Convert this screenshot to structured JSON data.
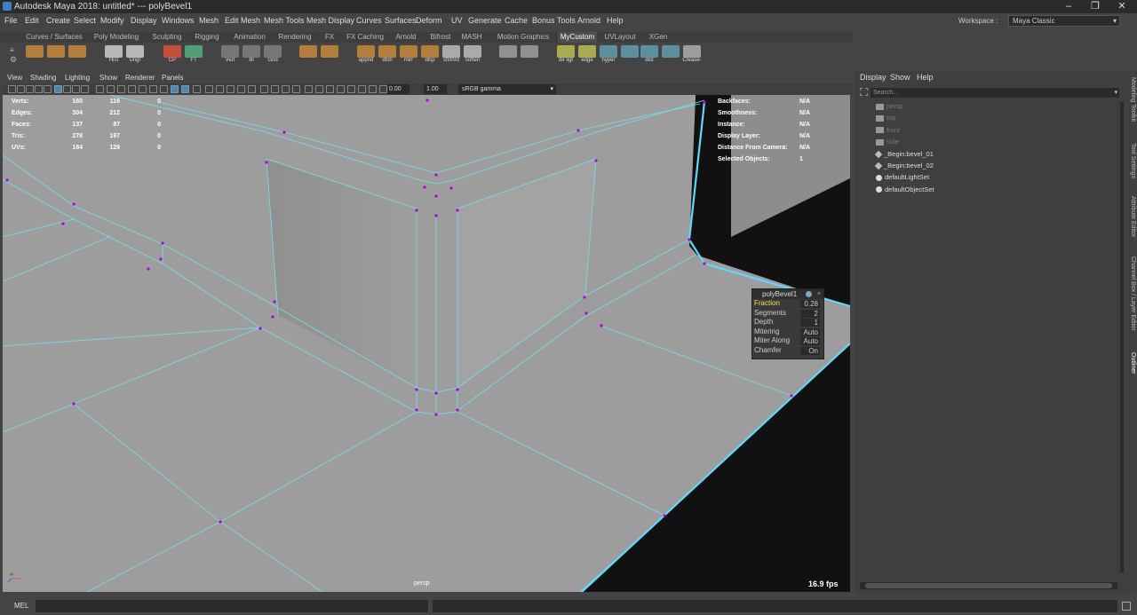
{
  "title_bar": {
    "title": "Autodesk Maya 2018: untitled*   ---   polyBevel1"
  },
  "menu": [
    "File",
    "Edit",
    "Create",
    "Select",
    "Modify",
    "Display",
    "Windows",
    "Mesh",
    "Edit Mesh",
    "Mesh Tools",
    "Mesh Display",
    "Curves",
    "Surfaces",
    "Deform",
    "UV",
    "Generate",
    "Cache",
    "Bonus Tools",
    "Arnold",
    "Help"
  ],
  "workspace": {
    "label": "Workspace :",
    "value": "Maya Classic"
  },
  "shelf_tabs": [
    "Curves / Surfaces",
    "Poly Modeling",
    "Sculpting",
    "Rigging",
    "Animation",
    "Rendering",
    "FX",
    "FX Caching",
    "Arnold",
    "Bifrost",
    "MASH",
    "Motion Graphics",
    "MyCustom",
    "UVLayout",
    "XGen"
  ],
  "shelf_active": "MyCustom",
  "shelf_icons": [
    {
      "label": "",
      "icon": "cube-icon"
    },
    {
      "label": "",
      "icon": "cube-icon"
    },
    {
      "label": "",
      "icon": "cube-icon"
    },
    {
      "label": "Hist",
      "icon": "history-icon"
    },
    {
      "label": "Ungr",
      "icon": "ungroup-icon"
    },
    {
      "label": "CP",
      "icon": "center-pivot-icon"
    },
    {
      "label": "FT",
      "icon": "freeze-icon"
    },
    {
      "label": "Vert",
      "icon": "vertex-icon"
    },
    {
      "label": "Bl",
      "icon": "blend-icon"
    },
    {
      "label": "Grid",
      "icon": "grid-icon"
    },
    {
      "label": "",
      "icon": "combine-icon"
    },
    {
      "label": "",
      "icon": "separate-icon"
    },
    {
      "label": "appnd",
      "icon": "append-icon"
    },
    {
      "label": "dtsh",
      "icon": "detach-icon"
    },
    {
      "label": "mirr",
      "icon": "mirror-icon"
    },
    {
      "label": "dlsp",
      "icon": "display-icon"
    },
    {
      "label": "sft/lhrd",
      "icon": "soft-hard-icon"
    },
    {
      "label": "soften",
      "icon": "soften-icon"
    },
    {
      "label": "",
      "icon": "uv-icon"
    },
    {
      "label": "",
      "icon": "paint-icon"
    },
    {
      "label": "dir ligt",
      "icon": "light-icon"
    },
    {
      "label": "edge",
      "icon": "edge-icon"
    },
    {
      "label": "hyper",
      "icon": "hypershade-icon"
    },
    {
      "label": "",
      "icon": "node-icon"
    },
    {
      "label": "dist",
      "icon": "distance-icon"
    },
    {
      "label": "",
      "icon": "snap-icon"
    },
    {
      "label": "Crease-",
      "icon": "crease-icon"
    }
  ],
  "viewport_menu": [
    "View",
    "Shading",
    "Lighting",
    "Show",
    "Renderer",
    "Panels"
  ],
  "viewport_toolbar": {
    "exposure": "0.00",
    "gamma_value": "1.00",
    "color_space": "sRGB gamma"
  },
  "hud_stats": {
    "rows": [
      {
        "label": "Verts:",
        "a": "160",
        "b": "116",
        "c": "0"
      },
      {
        "label": "Edges:",
        "a": "304",
        "b": "212",
        "c": "0"
      },
      {
        "label": "Faces:",
        "a": "137",
        "b": "97",
        "c": "0"
      },
      {
        "label": "Tris:",
        "a": "278",
        "b": "197",
        "c": "0"
      },
      {
        "label": "UVs:",
        "a": "184",
        "b": "129",
        "c": "0"
      }
    ]
  },
  "hud_info": {
    "rows": [
      {
        "label": "Backfaces:",
        "value": "N/A"
      },
      {
        "label": "Smoothness:",
        "value": "N/A"
      },
      {
        "label": "Instance:",
        "value": "N/A"
      },
      {
        "label": "Display Layer:",
        "value": "N/A"
      },
      {
        "label": "Distance From Camera:",
        "value": "N/A"
      },
      {
        "label": "Selected Objects:",
        "value": "1"
      }
    ]
  },
  "bevel_box": {
    "title": "polyBevel1",
    "rows": [
      {
        "label": "Fraction",
        "value": "0.28",
        "highlight": true
      },
      {
        "label": "Segments",
        "value": "2"
      },
      {
        "label": "Depth",
        "value": "1"
      },
      {
        "label": "Mitering",
        "value": "Auto"
      },
      {
        "label": "Miter Along",
        "value": "Auto"
      },
      {
        "label": "Chamfer",
        "value": "On"
      }
    ]
  },
  "viewport_camera": "persp",
  "fps": "16.9 fps",
  "outliner": {
    "menu": [
      "Display",
      "Show",
      "Help"
    ],
    "search_placeholder": "Search...",
    "items": [
      {
        "label": "persp",
        "dim": true,
        "icon": "camera-icon"
      },
      {
        "label": "top",
        "dim": true,
        "icon": "camera-icon"
      },
      {
        "label": "front",
        "dim": true,
        "icon": "camera-icon"
      },
      {
        "label": "side",
        "dim": true,
        "icon": "camera-icon"
      },
      {
        "label": "_Begin:bevel_01",
        "dim": false,
        "icon": "transform-icon"
      },
      {
        "label": "_Begin:bevel_02",
        "dim": false,
        "icon": "transform-icon"
      },
      {
        "label": "defaultLightSet",
        "dim": false,
        "icon": "set-icon"
      },
      {
        "label": "defaultObjectSet",
        "dim": false,
        "icon": "set-icon"
      }
    ]
  },
  "side_tabs": [
    "Modeling Toolkit",
    "Tool Settings",
    "Attribute Editor",
    "Channel Box / Layer Editor",
    "Outliner"
  ],
  "side_tab_active": "Outliner",
  "command_line": {
    "label": "MEL"
  }
}
